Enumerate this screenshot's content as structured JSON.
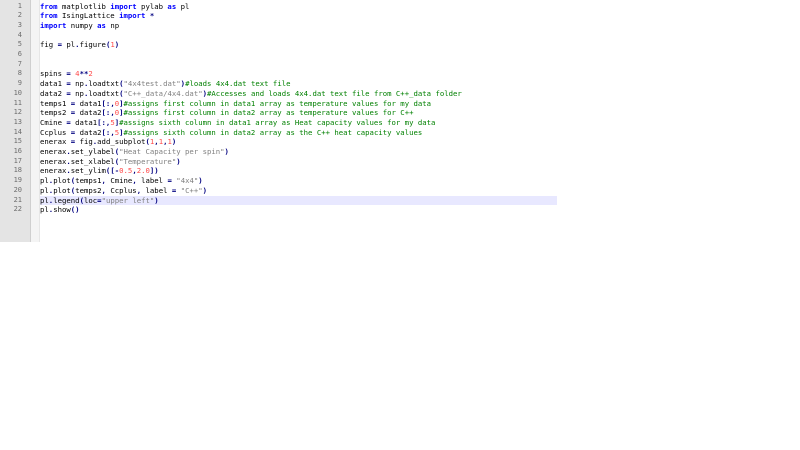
{
  "editor": {
    "current_line": 21,
    "lines": [
      {
        "n": "1",
        "t": [
          [
            "kw",
            "from"
          ],
          [
            "id",
            " matplotlib "
          ],
          [
            "kw",
            "import"
          ],
          [
            "id",
            " pylab "
          ],
          [
            "kw",
            "as"
          ],
          [
            "id",
            " pl"
          ]
        ]
      },
      {
        "n": "2",
        "t": [
          [
            "kw",
            "from"
          ],
          [
            "id",
            " IsingLattice "
          ],
          [
            "kw",
            "import"
          ],
          [
            "id",
            " "
          ],
          [
            "op",
            "*"
          ]
        ]
      },
      {
        "n": "3",
        "t": [
          [
            "kw",
            "import"
          ],
          [
            "id",
            " numpy "
          ],
          [
            "kw",
            "as"
          ],
          [
            "id",
            " np"
          ]
        ]
      },
      {
        "n": "4",
        "t": []
      },
      {
        "n": "5",
        "t": [
          [
            "id",
            "fig "
          ],
          [
            "op",
            "="
          ],
          [
            "id",
            " pl"
          ],
          [
            "op",
            "."
          ],
          [
            "id",
            "figure"
          ],
          [
            "op",
            "("
          ],
          [
            "num",
            "1"
          ],
          [
            "op",
            ")"
          ]
        ]
      },
      {
        "n": "6",
        "t": []
      },
      {
        "n": "7",
        "t": []
      },
      {
        "n": "8",
        "t": [
          [
            "id",
            "spins "
          ],
          [
            "op",
            "="
          ],
          [
            "id",
            " "
          ],
          [
            "num",
            "4"
          ],
          [
            "op",
            "**"
          ],
          [
            "num",
            "2"
          ]
        ]
      },
      {
        "n": "9",
        "t": [
          [
            "id",
            "data1 "
          ],
          [
            "op",
            "="
          ],
          [
            "id",
            " np"
          ],
          [
            "op",
            "."
          ],
          [
            "id",
            "loadtxt"
          ],
          [
            "op",
            "("
          ],
          [
            "str",
            "\"4x4test.dat\""
          ],
          [
            "op",
            ")"
          ],
          [
            "cm",
            "#loads 4x4.dat text file"
          ]
        ]
      },
      {
        "n": "10",
        "t": [
          [
            "id",
            "data2 "
          ],
          [
            "op",
            "="
          ],
          [
            "id",
            " np"
          ],
          [
            "op",
            "."
          ],
          [
            "id",
            "loadtxt"
          ],
          [
            "op",
            "("
          ],
          [
            "str",
            "\"C++_data/4x4.dat\""
          ],
          [
            "op",
            ")"
          ],
          [
            "cm",
            "#Accesses and loads 4x4.dat text file from C++_data folder"
          ]
        ]
      },
      {
        "n": "11",
        "t": [
          [
            "id",
            "temps1 "
          ],
          [
            "op",
            "="
          ],
          [
            "id",
            " data1"
          ],
          [
            "op",
            "[:,"
          ],
          [
            "num",
            "0"
          ],
          [
            "op",
            "]"
          ],
          [
            "cm",
            "#assigns first column in data1 array as temperature values for my data"
          ]
        ]
      },
      {
        "n": "12",
        "t": [
          [
            "id",
            "temps2 "
          ],
          [
            "op",
            "="
          ],
          [
            "id",
            " data2"
          ],
          [
            "op",
            "[:,"
          ],
          [
            "num",
            "0"
          ],
          [
            "op",
            "]"
          ],
          [
            "cm",
            "#assigns first column in data2 array as temperature values for C++"
          ]
        ]
      },
      {
        "n": "13",
        "t": [
          [
            "id",
            "Cmine "
          ],
          [
            "op",
            "="
          ],
          [
            "id",
            " data1"
          ],
          [
            "op",
            "[:,"
          ],
          [
            "num",
            "5"
          ],
          [
            "op",
            "]"
          ],
          [
            "cm",
            "#assigns sixth column in data1 array as Heat capacity values for my data"
          ]
        ]
      },
      {
        "n": "14",
        "t": [
          [
            "id",
            "Ccplus "
          ],
          [
            "op",
            "="
          ],
          [
            "id",
            " data2"
          ],
          [
            "op",
            "[:,"
          ],
          [
            "num",
            "5"
          ],
          [
            "op",
            "]"
          ],
          [
            "cm",
            "#assigns sixth column in data2 array as the C++ heat capacity values"
          ]
        ]
      },
      {
        "n": "15",
        "t": [
          [
            "id",
            "enerax "
          ],
          [
            "op",
            "="
          ],
          [
            "id",
            " fig"
          ],
          [
            "op",
            "."
          ],
          [
            "id",
            "add_subplot"
          ],
          [
            "op",
            "("
          ],
          [
            "num",
            "1"
          ],
          [
            "op",
            ","
          ],
          [
            "num",
            "1"
          ],
          [
            "op",
            ","
          ],
          [
            "num",
            "1"
          ],
          [
            "op",
            ")"
          ]
        ]
      },
      {
        "n": "16",
        "t": [
          [
            "id",
            "enerax"
          ],
          [
            "op",
            "."
          ],
          [
            "id",
            "set_ylabel"
          ],
          [
            "op",
            "("
          ],
          [
            "str",
            "\"Heat Capacity per spin\""
          ],
          [
            "op",
            ")"
          ]
        ]
      },
      {
        "n": "17",
        "t": [
          [
            "id",
            "enerax"
          ],
          [
            "op",
            "."
          ],
          [
            "id",
            "set_xlabel"
          ],
          [
            "op",
            "("
          ],
          [
            "str",
            "\"Temperature\""
          ],
          [
            "op",
            ")"
          ]
        ]
      },
      {
        "n": "18",
        "t": [
          [
            "id",
            "enerax"
          ],
          [
            "op",
            "."
          ],
          [
            "id",
            "set_ylim"
          ],
          [
            "op",
            "(["
          ],
          [
            "op",
            "-"
          ],
          [
            "num",
            "0.5"
          ],
          [
            "op",
            ","
          ],
          [
            "num",
            "2.0"
          ],
          [
            "op",
            "])"
          ]
        ]
      },
      {
        "n": "19",
        "t": [
          [
            "id",
            "pl"
          ],
          [
            "op",
            "."
          ],
          [
            "id",
            "plot"
          ],
          [
            "op",
            "("
          ],
          [
            "id",
            "temps1"
          ],
          [
            "op",
            ","
          ],
          [
            "id",
            " Cmine"
          ],
          [
            "op",
            ","
          ],
          [
            "id",
            " label "
          ],
          [
            "op",
            "="
          ],
          [
            "id",
            " "
          ],
          [
            "str",
            "\"4x4\""
          ],
          [
            "op",
            ")"
          ]
        ]
      },
      {
        "n": "20",
        "t": [
          [
            "id",
            "pl"
          ],
          [
            "op",
            "."
          ],
          [
            "id",
            "plot"
          ],
          [
            "op",
            "("
          ],
          [
            "id",
            "temps2"
          ],
          [
            "op",
            ","
          ],
          [
            "id",
            " Ccplus"
          ],
          [
            "op",
            ","
          ],
          [
            "id",
            " label "
          ],
          [
            "op",
            "="
          ],
          [
            "id",
            " "
          ],
          [
            "str",
            "\"C++\""
          ],
          [
            "op",
            ")"
          ]
        ]
      },
      {
        "n": "21",
        "t": [
          [
            "id",
            "pl"
          ],
          [
            "op",
            "."
          ],
          [
            "id",
            "legend"
          ],
          [
            "op",
            "("
          ],
          [
            "id",
            "loc"
          ],
          [
            "op",
            "="
          ],
          [
            "str",
            "\"upper left\""
          ],
          [
            "op",
            ")"
          ]
        ]
      },
      {
        "n": "22",
        "t": [
          [
            "id",
            "pl"
          ],
          [
            "op",
            "."
          ],
          [
            "id",
            "show"
          ],
          [
            "op",
            "()"
          ]
        ]
      }
    ]
  }
}
